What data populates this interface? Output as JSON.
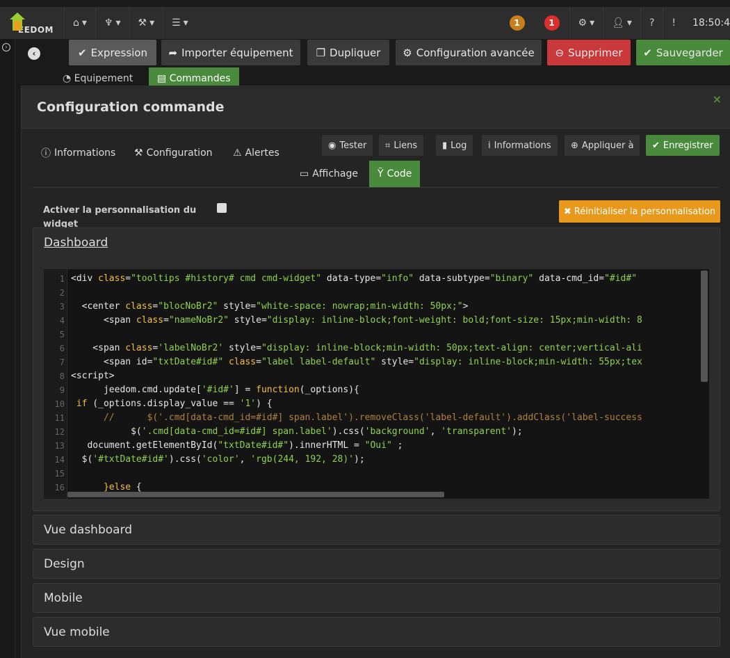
{
  "navbar": {
    "logo_text": "EEDOM",
    "menus": [
      {
        "name": "home-menu",
        "icon": "home-icon"
      },
      {
        "name": "plugins-menu",
        "icon": "plug-icon"
      },
      {
        "name": "tools-menu",
        "icon": "wrench-icon"
      },
      {
        "name": "analysis-menu",
        "icon": "bars-icon"
      }
    ],
    "badge_messages": "1",
    "badge_alerts": "1",
    "clock": "18:50:4"
  },
  "toolbar": {
    "expression": "Expression",
    "import": "Importer équipement",
    "duplicate": "Dupliquer",
    "advanced": "Configuration avancée",
    "delete": "Supprimer",
    "save": "Sauvegarder"
  },
  "bg_tabs": {
    "equipment": "Equipement",
    "commands": "Commandes"
  },
  "modal": {
    "title": "Configuration commande",
    "close": "×",
    "tabs_left": [
      "Informations",
      "Configuration",
      "Alertes"
    ],
    "buttons": {
      "test": "Tester",
      "links": "Liens",
      "log": "Log",
      "info": "Informations",
      "apply": "Appliquer à",
      "save": "Enregistrer"
    },
    "content_tabs": {
      "display": "Affichage",
      "code": "Code"
    },
    "perso_label": "Activer la personnalisation du widget",
    "reset_label": "Réinitialiser la personnalisation",
    "panels": {
      "dashboard": "Dashboard",
      "vue_dashboard": "Vue dashboard",
      "design": "Design",
      "mobile": "Mobile",
      "vue_mobile": "Vue mobile"
    }
  },
  "code_lines": [
    "1",
    "2",
    "3",
    "4",
    "5",
    "6",
    "7",
    "8",
    "9",
    "10",
    "11",
    "12",
    "13",
    "14",
    "15",
    "16"
  ],
  "colors": {
    "green": "#4a8a3c",
    "red": "#c9383a",
    "orange": "#e8991c"
  }
}
